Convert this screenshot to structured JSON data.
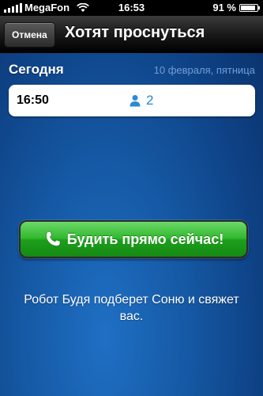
{
  "status_bar": {
    "carrier": "MegaFon",
    "time": "16:53",
    "battery_text": "91 %",
    "battery_level": 0.91,
    "signal_bars": 5
  },
  "nav": {
    "cancel_label": "Отмена",
    "title": "Хотят проснуться"
  },
  "section": {
    "title": "Сегодня",
    "date": "10 февраля, пятница"
  },
  "alarm": {
    "time": "16:50",
    "count": "2"
  },
  "wake_button": {
    "label": "Будить прямо сейчас!"
  },
  "description": "Робот Будя подберет Соню и свяжет вас.",
  "colors": {
    "accent_blue": "#2a8ad6",
    "button_green": "#2fb82c",
    "background": "#165aa6"
  },
  "icons": {
    "person": "person-icon",
    "phone": "phone-icon",
    "wifi": "wifi-icon"
  }
}
